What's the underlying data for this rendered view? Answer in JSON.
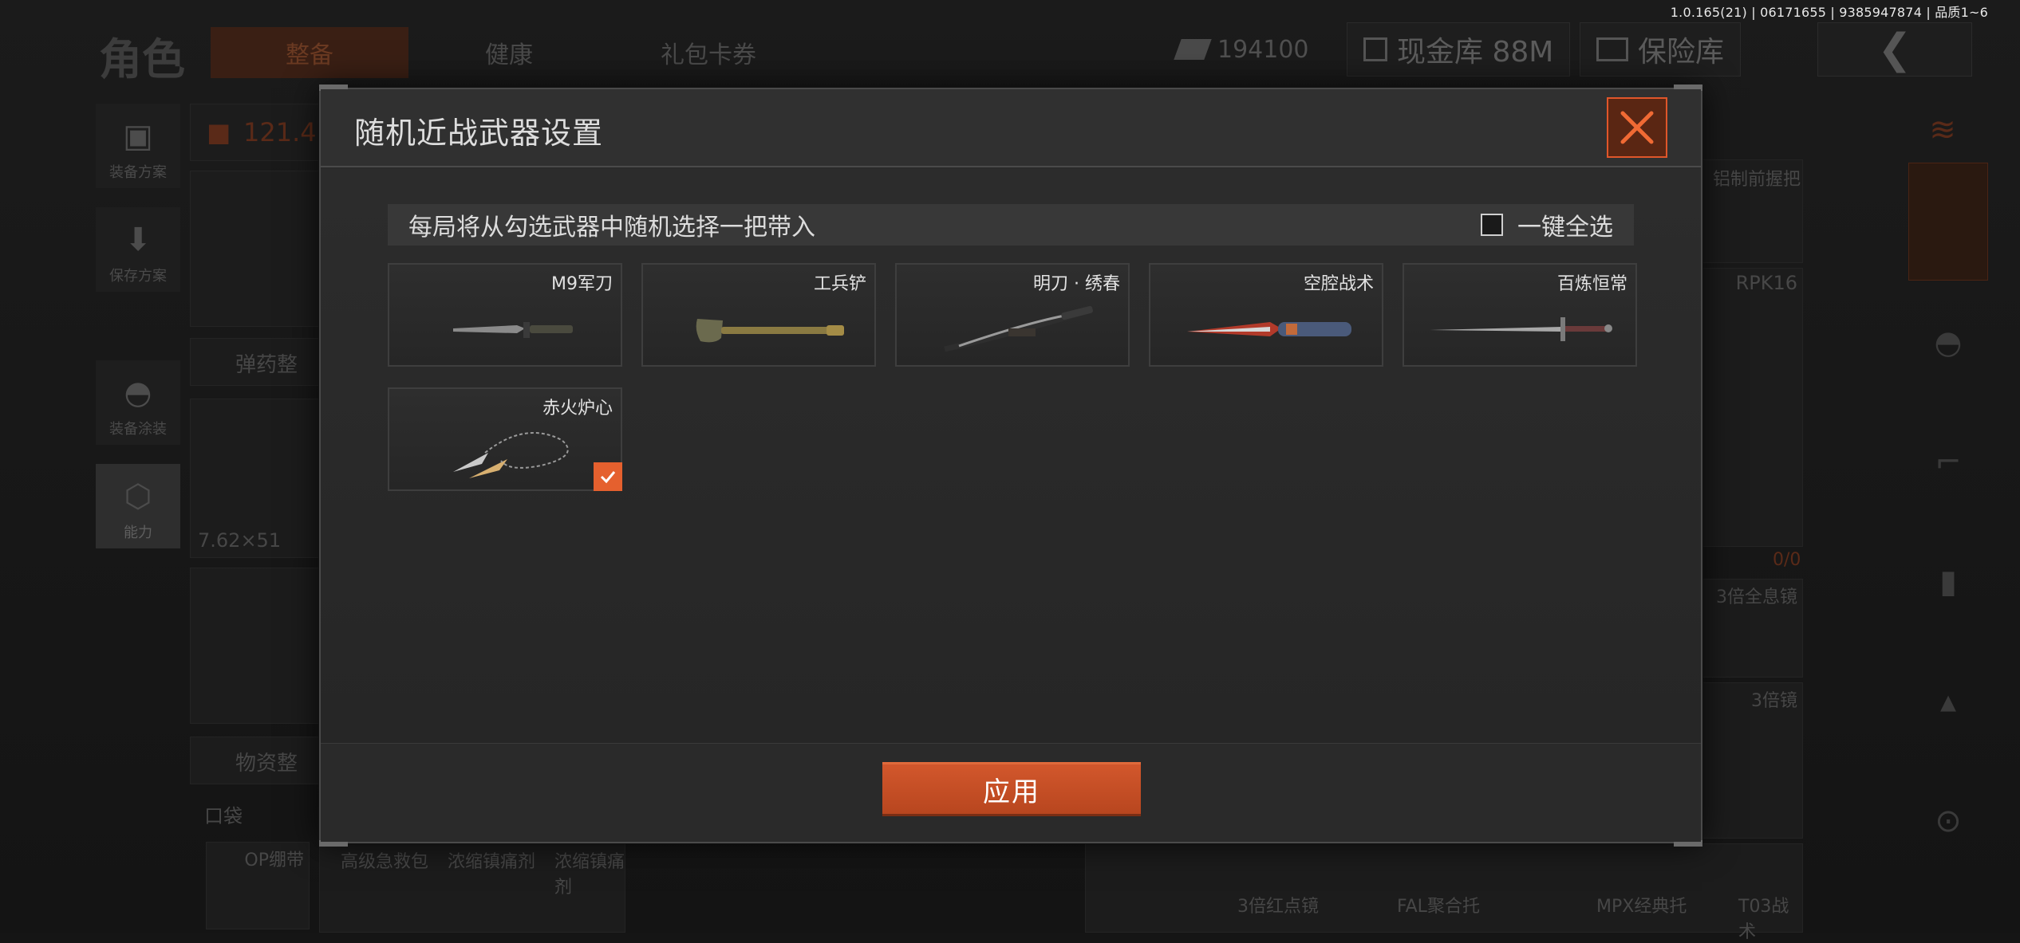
{
  "version_text": "1.0.165(21) | 06171655 | 9385947874 | 品质1~6",
  "background": {
    "title": "角色",
    "tabs": [
      "整备",
      "健康",
      "礼包卡券"
    ],
    "cash": "194100",
    "cash_vault": "现金库 88M",
    "safe_box": "保险库",
    "sidebar": [
      "装备方案",
      "保存方案",
      "装备涂装",
      "能力"
    ],
    "weight": "121.42",
    "ammo_section": "弹药整",
    "caliber": "7.62×51",
    "supplies_section": "物资整",
    "pocket_label": "口袋",
    "pocket_items": [
      "OP绷带",
      "高级急救包",
      "浓缩镇痛剂",
      "浓缩镇痛剂"
    ],
    "right_items": [
      "铝制前握把",
      "RPK16",
      "0/0",
      "3倍全息镜",
      "3倍镜",
      "3倍红点镜",
      "FAL聚合托",
      "MPX经典托",
      "T03战术"
    ]
  },
  "modal": {
    "title": "随机近战武器设置",
    "info": "每局将从勾选武器中随机选择一把带入",
    "select_all": "一键全选",
    "weapons": [
      {
        "name": "M9军刀",
        "checked": false,
        "icon": "bayonet-knife-icon"
      },
      {
        "name": "工兵铲",
        "checked": false,
        "icon": "shovel-icon"
      },
      {
        "name": "明刀 · 绣春",
        "checked": false,
        "icon": "saber-icon"
      },
      {
        "name": "空腔战术",
        "checked": false,
        "icon": "tactical-blade-icon"
      },
      {
        "name": "百炼恒常",
        "checked": false,
        "icon": "long-sword-icon"
      },
      {
        "name": "赤火炉心",
        "checked": true,
        "icon": "chain-kunai-icon"
      }
    ],
    "apply": "应用"
  },
  "colors": {
    "accent": "#E5602E",
    "modal_bg": "#2B2B2B",
    "close_bg": "#5A2613"
  }
}
